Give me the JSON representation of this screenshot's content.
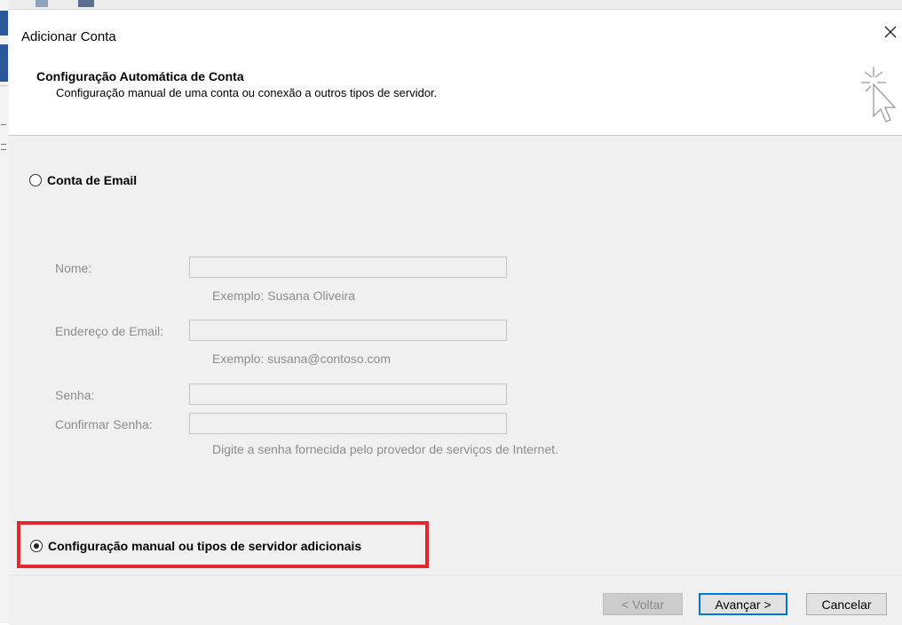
{
  "dialog": {
    "title": "Adicionar Conta",
    "header_title": "Configuração Automática de Conta",
    "header_subtitle": "Configuração manual de uma conta ou conexão a outros tipos de servidor."
  },
  "options": {
    "email_account": {
      "label": "Conta de Email",
      "selected": false
    },
    "manual": {
      "label": "Configuração manual ou tipos de servidor adicionais",
      "selected": true
    }
  },
  "form": {
    "name": {
      "label": "Nome:",
      "value": "",
      "hint": "Exemplo: Susana Oliveira"
    },
    "email": {
      "label": "Endereço de Email:",
      "value": "",
      "hint": "Exemplo: susana@contoso.com"
    },
    "password": {
      "label": "Senha:",
      "value": ""
    },
    "confirm": {
      "label": "Confirmar Senha:",
      "value": ""
    },
    "password_hint": "Digite a senha fornecida pelo provedor de serviços de Internet."
  },
  "buttons": {
    "back": "< Voltar",
    "next": "Avançar >",
    "cancel": "Cancelar"
  },
  "colors": {
    "highlight": "#e6262f",
    "primary_border": "#0078d7",
    "dialog_body": "#f0f0f0"
  }
}
